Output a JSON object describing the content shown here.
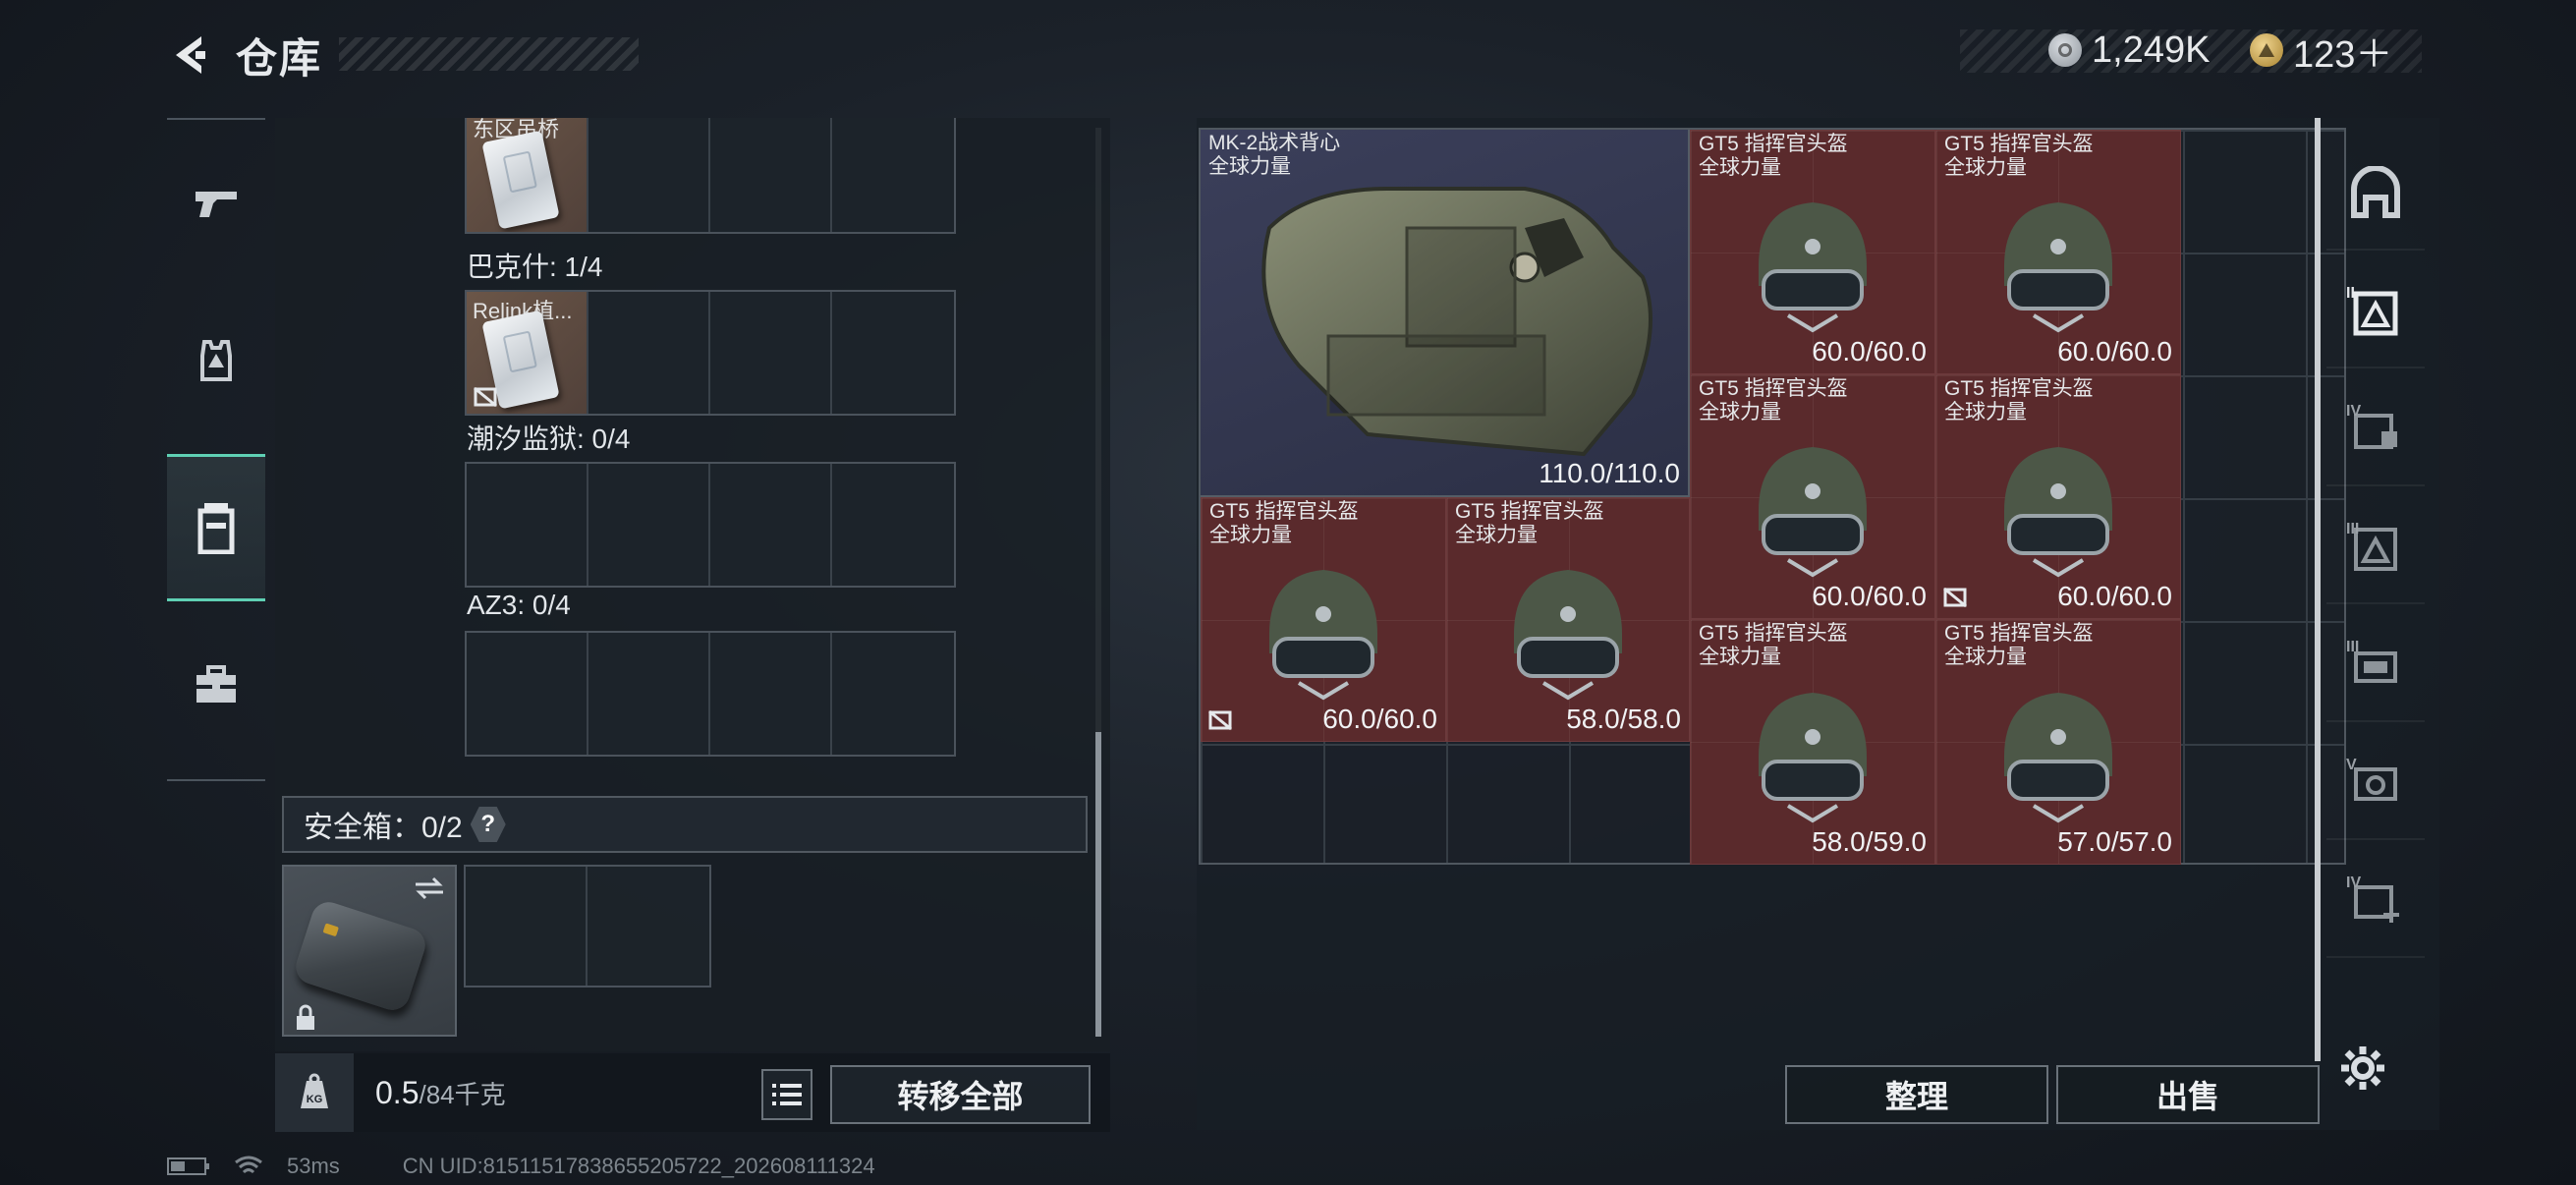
{
  "header": {
    "title": "仓库"
  },
  "currency": {
    "silver": "1,249K",
    "gold": "123＋"
  },
  "containers": [
    {
      "name": "",
      "items": [
        {
          "label": "东区吊桥"
        }
      ]
    },
    {
      "name": "巴克什: 1/4",
      "items": [
        {
          "label": "Relink植..."
        }
      ]
    },
    {
      "name": "潮汐监狱: 0/4",
      "items": []
    },
    {
      "name": "AZ3: 0/4",
      "items": []
    }
  ],
  "safebox": {
    "label": "安全箱：0/2",
    "help": "?"
  },
  "weight": {
    "current": "0.5",
    "max": "/84千克",
    "icon_label": "KG"
  },
  "buttons": {
    "transfer_all": "转移全部",
    "sort": "整理",
    "sell": "出售"
  },
  "stash": {
    "vest": {
      "name": "MK-2战术背心",
      "mode": "全球力量",
      "durability": "110.0/110.0"
    },
    "helmets": [
      {
        "name": "GT5 指挥官头盔",
        "mode": "全球力量",
        "durability": "60.0/60.0"
      },
      {
        "name": "GT5 指挥官头盔",
        "mode": "全球力量",
        "durability": "60.0/60.0"
      },
      {
        "name": "GT5 指挥官头盔",
        "mode": "全球力量",
        "durability": "60.0/60.0"
      },
      {
        "name": "GT5 指挥官头盔",
        "mode": "全球力量",
        "durability": "60.0/60.0"
      },
      {
        "name": "GT5 指挥官头盔",
        "mode": "全球力量",
        "durability": "60.0/60.0"
      },
      {
        "name": "GT5 指挥官头盔",
        "mode": "全球力量",
        "durability": "58.0/58.0"
      },
      {
        "name": "GT5 指挥官头盔",
        "mode": "全球力量",
        "durability": "58.0/59.0"
      },
      {
        "name": "GT5 指挥官头盔",
        "mode": "全球力量",
        "durability": "57.0/57.0"
      }
    ]
  },
  "right_rail": [
    "II",
    "IV",
    "III",
    "III",
    "V",
    "IV"
  ],
  "status": {
    "ping": "53ms",
    "uid": "CN UID:8151151783865520572​2_202608111324"
  },
  "colors": {
    "accent": "#5fd0b4",
    "helmet_bg": "#5a2a2c"
  }
}
